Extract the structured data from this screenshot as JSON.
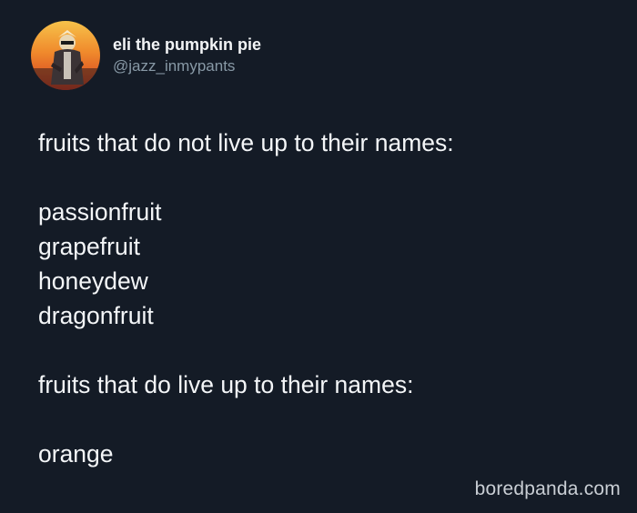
{
  "author": {
    "display_name": "eli the pumpkin pie",
    "handle": "@jazz_inmypants",
    "avatar_icon": "profile-avatar"
  },
  "tweet": {
    "heading_1": "fruits that do not live up to their names:",
    "list_1": [
      "passionfruit",
      "grapefruit",
      "honeydew",
      "dragonfruit"
    ],
    "heading_2": "fruits that do live up to their names:",
    "list_2": [
      "orange"
    ]
  },
  "watermark": "boredpanda.com",
  "colors": {
    "background": "#141b26",
    "text": "#f4f6f8",
    "handle": "#8899a6"
  }
}
